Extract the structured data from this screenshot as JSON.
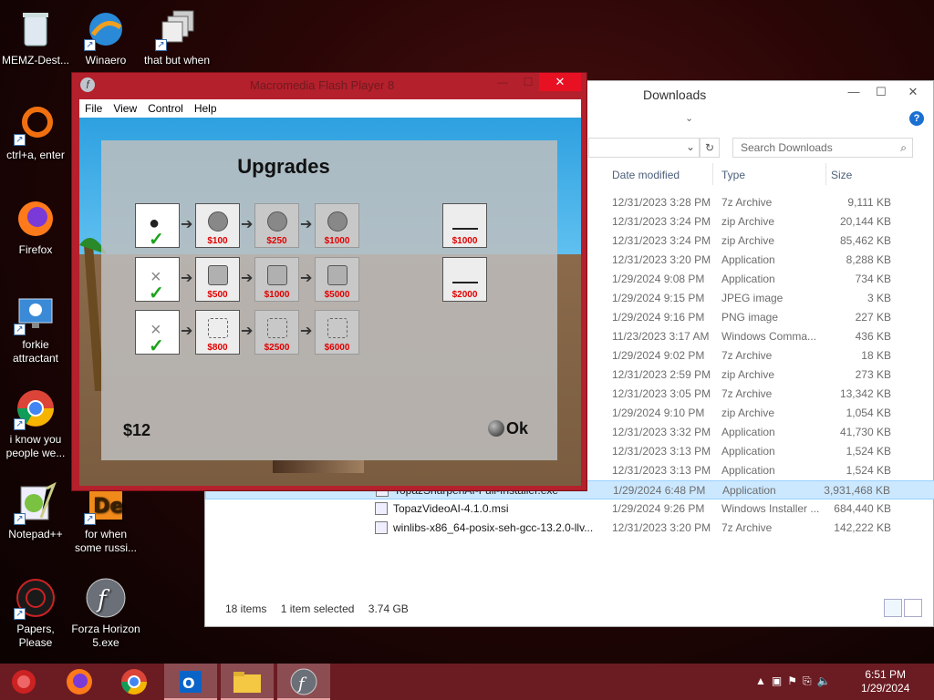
{
  "desktop": {
    "icons": [
      {
        "label": "MEMZ-Dest...",
        "icon": "recycle-bin-icon"
      },
      {
        "label": "Winaero Tweaker",
        "icon": "winaero-icon"
      },
      {
        "label": "that but when",
        "icon": "folder-shortcut-icon"
      },
      {
        "label": "ctrl+a, enter",
        "icon": "orange-ring-icon"
      },
      {
        "label": "Firefox",
        "icon": "firefox-icon"
      },
      {
        "label": "forkie attractant",
        "icon": "monitor-gear-icon"
      },
      {
        "label": "i know you people we...",
        "icon": "chrome-icon"
      },
      {
        "label": "Notepad++",
        "icon": "notepadpp-icon"
      },
      {
        "label": "for when some russi...",
        "icon": "de-icon"
      },
      {
        "label": "Papers, Please",
        "icon": "papers-please-icon"
      },
      {
        "label": "Forza Horizon 5.exe",
        "icon": "flash-icon"
      }
    ]
  },
  "explorer": {
    "title": "Downloads",
    "search_placeholder": "Search Downloads",
    "columns": {
      "date": "Date modified",
      "type": "Type",
      "size": "Size"
    },
    "rows": [
      {
        "name": "",
        "date": "12/31/2023 3:28 PM",
        "type": "7z Archive",
        "size": "9,111 KB"
      },
      {
        "name": "",
        "date": "12/31/2023 3:24 PM",
        "type": "zip Archive",
        "size": "20,144 KB"
      },
      {
        "name": "",
        "date": "12/31/2023 3:24 PM",
        "type": "zip Archive",
        "size": "85,462 KB"
      },
      {
        "name": "",
        "date": "12/31/2023 3:20 PM",
        "type": "Application",
        "size": "8,288 KB"
      },
      {
        "name": "",
        "date": "1/29/2024 9:08 PM",
        "type": "Application",
        "size": "734 KB"
      },
      {
        "name": "",
        "date": "1/29/2024 9:15 PM",
        "type": "JPEG image",
        "size": "3 KB"
      },
      {
        "name": "",
        "date": "1/29/2024 9:16 PM",
        "type": "PNG image",
        "size": "227 KB"
      },
      {
        "name": "",
        "date": "11/23/2023 3:17 AM",
        "type": "Windows Comma...",
        "size": "436 KB"
      },
      {
        "name": "",
        "date": "1/29/2024 9:02 PM",
        "type": "7z Archive",
        "size": "18 KB"
      },
      {
        "name": "",
        "date": "12/31/2023 2:59 PM",
        "type": "zip Archive",
        "size": "273 KB"
      },
      {
        "name": "",
        "date": "12/31/2023 3:05 PM",
        "type": "7z Archive",
        "size": "13,342 KB"
      },
      {
        "name": "",
        "date": "1/29/2024 9:10 PM",
        "type": "zip Archive",
        "size": "1,054 KB"
      },
      {
        "name": "",
        "date": "12/31/2023 3:32 PM",
        "type": "Application",
        "size": "41,730 KB"
      },
      {
        "name": "",
        "date": "12/31/2023 3:13 PM",
        "type": "Application",
        "size": "1,524 KB"
      },
      {
        "name": "",
        "date": "12/31/2023 3:13 PM",
        "type": "Application",
        "size": "1,524 KB"
      },
      {
        "name": "TopazSharpenAI-Full-Installer.exe",
        "date": "1/29/2024 6:48 PM",
        "type": "Application",
        "size": "3,931,468 KB"
      },
      {
        "name": "TopazVideoAI-4.1.0.msi",
        "date": "1/29/2024 9:26 PM",
        "type": "Windows Installer ...",
        "size": "684,440 KB"
      },
      {
        "name": "winlibs-x86_64-posix-seh-gcc-13.2.0-llv...",
        "date": "12/31/2023 3:20 PM",
        "type": "7z Archive",
        "size": "142,222 KB"
      }
    ],
    "status": {
      "count": "18 items",
      "selected": "1 item selected",
      "size": "3.74 GB"
    }
  },
  "flash": {
    "title": "Macromedia Flash Player 8",
    "menu": [
      "File",
      "View",
      "Control",
      "Help"
    ],
    "game": {
      "heading": "Upgrades",
      "money": "$12",
      "ok": "Ok",
      "rows": [
        [
          "",
          "$100",
          "$250",
          "$1000"
        ],
        [
          "",
          "$500",
          "$1000",
          "$5000"
        ],
        [
          "",
          "$800",
          "$2500",
          "$6000"
        ]
      ],
      "side": [
        "$1000",
        "$2000"
      ]
    }
  },
  "taskbar": {
    "time": "6:51 PM",
    "date": "1/29/2024"
  }
}
